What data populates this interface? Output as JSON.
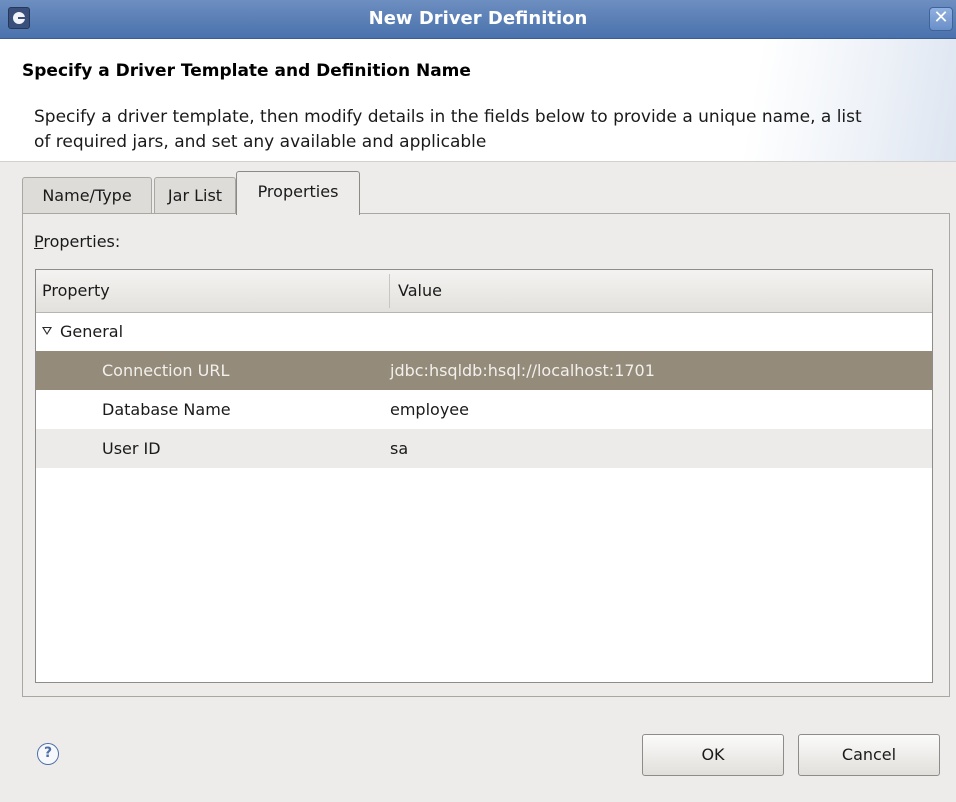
{
  "window": {
    "title": "New Driver Definition",
    "close_glyph": "✕",
    "app_icon": "eclipse-icon"
  },
  "header": {
    "title": "Specify a Driver Template and Definition Name",
    "description": "Specify a driver template, then modify details in the fields below to provide a unique name, a list of required jars, and set any available and applicable"
  },
  "tabs": [
    {
      "label": "Name/Type",
      "active": false
    },
    {
      "label": "Jar List",
      "active": false
    },
    {
      "label": "Properties",
      "active": true
    }
  ],
  "properties": {
    "label_mnemonic": "P",
    "label_rest": "roperties:",
    "columns": [
      "Property",
      "Value"
    ],
    "group": "General",
    "rows": [
      {
        "property": "Connection URL",
        "value": "jdbc:hsqldb:hsql://localhost:1701",
        "selected": true
      },
      {
        "property": "Database Name",
        "value": "employee",
        "selected": false
      },
      {
        "property": "User ID",
        "value": "sa",
        "selected": false
      }
    ]
  },
  "footer": {
    "help_glyph": "?",
    "ok_label": "OK",
    "cancel_label": "Cancel"
  },
  "colors": {
    "titlebar": "#4a72ad",
    "selected_row": "#948b7b",
    "dialog_bg": "#edeceb"
  }
}
